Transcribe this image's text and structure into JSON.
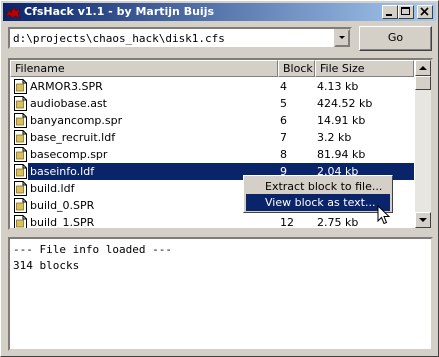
{
  "window": {
    "title": "CfsHack v1.1 - by Martijn Buijs"
  },
  "path_combo": {
    "value": "d:\\projects\\chaos_hack\\disk1.cfs"
  },
  "go_button": {
    "label": "Go"
  },
  "list": {
    "columns": [
      "Filename",
      "Block",
      "File Size"
    ],
    "rows": [
      {
        "name": "ARMOR3.SPR",
        "block": "4",
        "size": "4.13 kb",
        "selected": false
      },
      {
        "name": "audiobase.ast",
        "block": "5",
        "size": "424.52 kb",
        "selected": false
      },
      {
        "name": "banyancomp.spr",
        "block": "6",
        "size": "14.91 kb",
        "selected": false
      },
      {
        "name": "base_recruit.ldf",
        "block": "7",
        "size": "3.2 kb",
        "selected": false
      },
      {
        "name": "basecomp.spr",
        "block": "8",
        "size": "81.94 kb",
        "selected": false
      },
      {
        "name": "baseinfo.ldf",
        "block": "9",
        "size": "2.04 kb",
        "selected": true
      },
      {
        "name": "build.ldf",
        "block": "",
        "size": "",
        "selected": false
      },
      {
        "name": "build_0.SPR",
        "block": "",
        "size": "",
        "selected": false
      },
      {
        "name": "build_1.SPR",
        "block": "12",
        "size": "2.75 kb",
        "selected": false
      }
    ]
  },
  "context_menu": {
    "items": [
      {
        "label": "Extract block to file...",
        "highlighted": false
      },
      {
        "label": "View block as text...",
        "highlighted": true
      }
    ]
  },
  "output": {
    "lines": [
      "--- File info loaded ---",
      "314 blocks"
    ]
  },
  "colors": {
    "titlebar_start": "#0a246a",
    "titlebar_end": "#a6caf0",
    "selection": "#0a246a",
    "face": "#d4d0c8"
  }
}
